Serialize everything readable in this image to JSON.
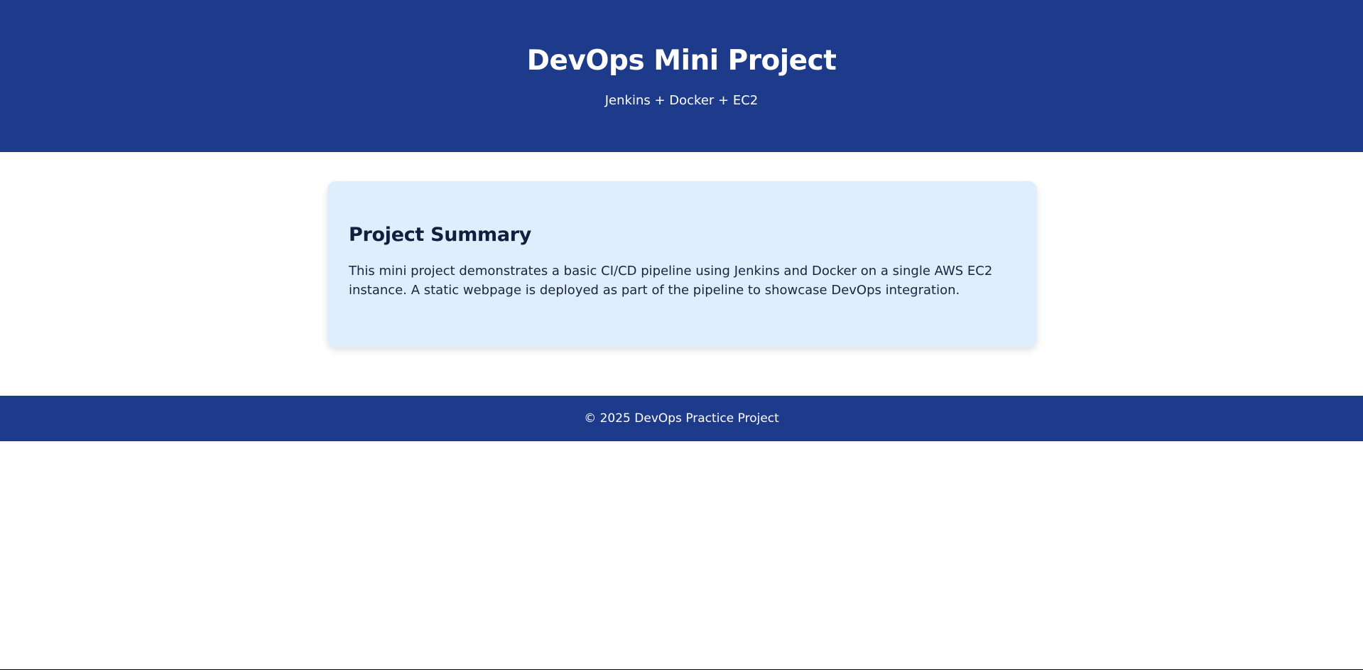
{
  "header": {
    "title": "DevOps Mini Project",
    "subtitle": "Jenkins + Docker + EC2"
  },
  "summary": {
    "heading": "Project Summary",
    "body": "This mini project demonstrates a basic CI/CD pipeline using Jenkins and Docker on a single AWS EC2 instance. A static webpage is deployed as part of the pipeline to showcase DevOps integration."
  },
  "footer": {
    "text": "© 2025 DevOps Practice Project"
  },
  "colors": {
    "brand": "#1e3a8a",
    "card_background": "#dfeefd",
    "heading_text": "#0f1f3d"
  }
}
